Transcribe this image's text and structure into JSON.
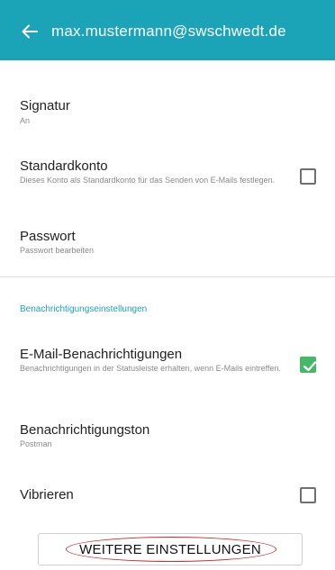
{
  "appbar": {
    "title": "max.mustermann@swschwedt.de",
    "color": "#1ba3b8"
  },
  "settings": {
    "signatur": {
      "title": "Signatur",
      "subtitle": "An"
    },
    "standardkonto": {
      "title": "Standardkonto",
      "subtitle": "Dieses Konto als Standardkonto für das Senden von E-Mails festlegen.",
      "checked": false
    },
    "passwort": {
      "title": "Passwort",
      "subtitle": "Passwort bearbeiten"
    },
    "section_header": "Benachrichtigungseinstellungen",
    "email_benachrichtigungen": {
      "title": "E-Mail-Benachrichtigungen",
      "subtitle": "Benachrichtigungen in der Statusleiste erhalten, wenn E-Mails eintreffen.",
      "checked": true
    },
    "benachrichtigungston": {
      "title": "Benachrichtigungston",
      "subtitle": "Postman"
    },
    "vibrieren": {
      "title": "Vibrieren",
      "checked": false
    }
  },
  "bottom": {
    "button_label": "WEITERE EINSTELLUNGEN"
  },
  "colors": {
    "accent": "#1ba3b8",
    "check_green": "#45b86a",
    "highlight_red": "#d42a2a"
  },
  "icons": {
    "back": "back-arrow-icon",
    "checkmark": "checkmark-icon"
  }
}
